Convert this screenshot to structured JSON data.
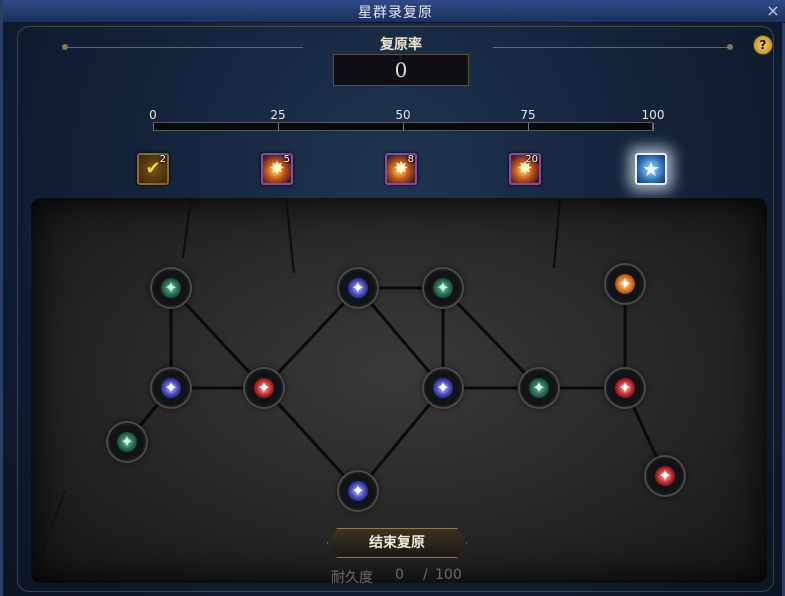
{
  "window": {
    "title": "星群录复原",
    "close_glyph": "×"
  },
  "help": {
    "glyph": "?"
  },
  "restore_rate": {
    "label": "复原率",
    "value": "0"
  },
  "progress": {
    "value": 0,
    "ticks": [
      "0",
      "25",
      "50",
      "75",
      "100"
    ]
  },
  "rewards": [
    {
      "icon": "checkmark-icon",
      "count": "2",
      "state": "claimed"
    },
    {
      "icon": "star-burst-icon",
      "count": "5",
      "state": "locked"
    },
    {
      "icon": "star-burst-icon",
      "count": "8",
      "state": "locked"
    },
    {
      "icon": "star-burst-icon",
      "count": "20",
      "state": "locked"
    },
    {
      "icon": "blue-star-icon",
      "count": "",
      "state": "highlighted"
    }
  ],
  "star_colors": {
    "green": "#2e8a63",
    "blue": "#4a53d8",
    "red": "#c92a2a",
    "orange": "#e07d1c"
  },
  "stars": [
    {
      "id": "g1",
      "color": "green"
    },
    {
      "id": "b1",
      "color": "blue"
    },
    {
      "id": "g2",
      "color": "green"
    },
    {
      "id": "o1",
      "color": "orange"
    },
    {
      "id": "b2",
      "color": "blue"
    },
    {
      "id": "r1",
      "color": "red"
    },
    {
      "id": "b3",
      "color": "blue"
    },
    {
      "id": "g3",
      "color": "green"
    },
    {
      "id": "r2",
      "color": "red"
    },
    {
      "id": "g4",
      "color": "green"
    },
    {
      "id": "r3",
      "color": "red"
    },
    {
      "id": "b4",
      "color": "blue"
    }
  ],
  "links": [
    [
      "g1",
      "b2"
    ],
    [
      "g1",
      "r1"
    ],
    [
      "b2",
      "r1"
    ],
    [
      "b2",
      "g4"
    ],
    [
      "r1",
      "b1"
    ],
    [
      "r1",
      "b4"
    ],
    [
      "b1",
      "g2"
    ],
    [
      "b1",
      "b3"
    ],
    [
      "g2",
      "b3"
    ],
    [
      "g2",
      "g3"
    ],
    [
      "b3",
      "g3"
    ],
    [
      "b3",
      "b4"
    ],
    [
      "g3",
      "r2"
    ],
    [
      "r2",
      "o1"
    ],
    [
      "r2",
      "r3"
    ]
  ],
  "end_button": {
    "label": "结束复原"
  },
  "durability": {
    "label": "耐久度",
    "current": "0",
    "separator": "/",
    "max": "100"
  }
}
